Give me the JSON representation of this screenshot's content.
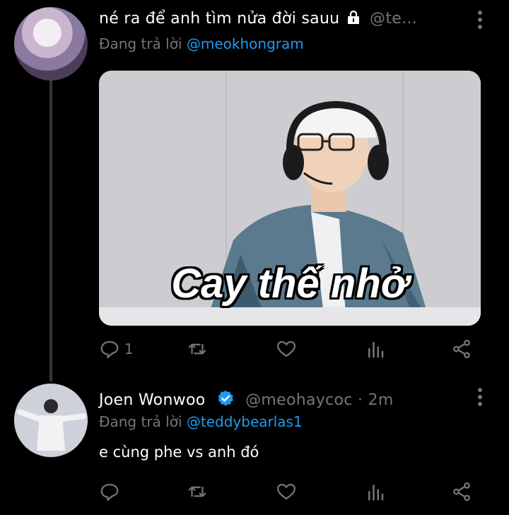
{
  "tweet1": {
    "text": "né ra để anh tìm nửa đời sauu",
    "handle": "@te...",
    "replying_prefix": "Đang trả lời",
    "replying_to": "@meokhongram",
    "media_caption": "Cay thế nhở",
    "reply_count": "1",
    "icons": [
      "lock-icon",
      "more-icon",
      "reply-icon",
      "retweet-icon",
      "like-icon",
      "analytics-icon",
      "share-icon"
    ]
  },
  "tweet2": {
    "name": "Joen Wonwoo",
    "handle": "@meohaycoc",
    "separator": "·",
    "time": "2m",
    "replying_prefix": "Đang trả lời",
    "replying_to": "@teddybearlas1",
    "text": "e cùng phe vs anh đó",
    "icons": [
      "verified-icon",
      "more-icon",
      "reply-icon",
      "retweet-icon",
      "like-icon",
      "analytics-icon",
      "share-icon"
    ]
  },
  "colors": {
    "background": "#000000",
    "text": "#ffffff",
    "muted": "#71767b",
    "link": "#1d9bf0",
    "thread_line": "#333639"
  }
}
